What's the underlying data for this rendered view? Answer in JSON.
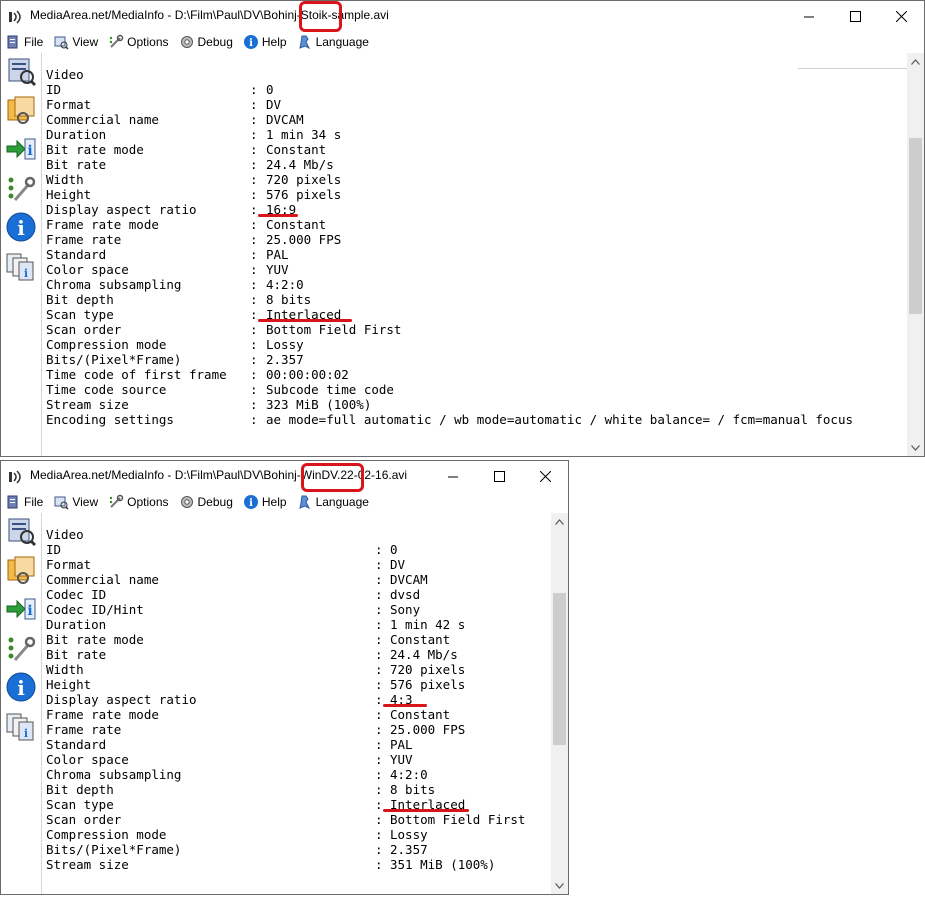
{
  "windows": [
    {
      "title": "MediaArea.net/MediaInfo - D:\\Film\\Paul\\DV\\Bohinj-Stoik-sample.avi",
      "menu": [
        {
          "label": "File",
          "icon": "file-icon"
        },
        {
          "label": "View",
          "icon": "view-icon"
        },
        {
          "label": "Options",
          "icon": "options-icon"
        },
        {
          "label": "Debug",
          "icon": "debug-icon"
        },
        {
          "label": "Help",
          "icon": "help-icon"
        },
        {
          "label": "Language",
          "icon": "language-icon"
        }
      ],
      "section": "Video",
      "rows": [
        {
          "key": "ID",
          "value": "0"
        },
        {
          "key": "Format",
          "value": "DV"
        },
        {
          "key": "Commercial name",
          "value": "DVCAM"
        },
        {
          "key": "Duration",
          "value": "1 min 34 s"
        },
        {
          "key": "Bit rate mode",
          "value": "Constant"
        },
        {
          "key": "Bit rate",
          "value": "24.4 Mb/s"
        },
        {
          "key": "Width",
          "value": "720 pixels"
        },
        {
          "key": "Height",
          "value": "576 pixels"
        },
        {
          "key": "Display aspect ratio",
          "value": "16:9"
        },
        {
          "key": "Frame rate mode",
          "value": "Constant"
        },
        {
          "key": "Frame rate",
          "value": "25.000 FPS"
        },
        {
          "key": "Standard",
          "value": "PAL"
        },
        {
          "key": "Color space",
          "value": "YUV"
        },
        {
          "key": "Chroma subsampling",
          "value": "4:2:0"
        },
        {
          "key": "Bit depth",
          "value": "8 bits"
        },
        {
          "key": "Scan type",
          "value": "Interlaced"
        },
        {
          "key": "Scan order",
          "value": "Bottom Field First"
        },
        {
          "key": "Compression mode",
          "value": "Lossy"
        },
        {
          "key": "Bits/(Pixel*Frame)",
          "value": "2.357"
        },
        {
          "key": "Time code of first frame",
          "value": "00:00:00:02"
        },
        {
          "key": "Time code source",
          "value": "Subcode time code"
        },
        {
          "key": "Stream size",
          "value": "323 MiB (100%)"
        },
        {
          "key": "Encoding settings",
          "value": "ae mode=full automatic / wb mode=automatic / white balance= / fcm=manual focus"
        }
      ]
    },
    {
      "title": "MediaArea.net/MediaInfo - D:\\Film\\Paul\\DV\\Bohinj-WinDV.22-02-16.avi",
      "menu": [
        {
          "label": "File",
          "icon": "file-icon"
        },
        {
          "label": "View",
          "icon": "view-icon"
        },
        {
          "label": "Options",
          "icon": "options-icon"
        },
        {
          "label": "Debug",
          "icon": "debug-icon"
        },
        {
          "label": "Help",
          "icon": "help-icon"
        },
        {
          "label": "Language",
          "icon": "language-icon"
        }
      ],
      "section": "Video",
      "rows": [
        {
          "key": "ID",
          "value": "0"
        },
        {
          "key": "Format",
          "value": "DV"
        },
        {
          "key": "Commercial name",
          "value": "DVCAM"
        },
        {
          "key": "Codec ID",
          "value": "dvsd"
        },
        {
          "key": "Codec ID/Hint",
          "value": "Sony"
        },
        {
          "key": "Duration",
          "value": "1 min 42 s"
        },
        {
          "key": "Bit rate mode",
          "value": "Constant"
        },
        {
          "key": "Bit rate",
          "value": "24.4 Mb/s"
        },
        {
          "key": "Width",
          "value": "720 pixels"
        },
        {
          "key": "Height",
          "value": "576 pixels"
        },
        {
          "key": "Display aspect ratio",
          "value": "4:3"
        },
        {
          "key": "Frame rate mode",
          "value": "Constant"
        },
        {
          "key": "Frame rate",
          "value": "25.000 FPS"
        },
        {
          "key": "Standard",
          "value": "PAL"
        },
        {
          "key": "Color space",
          "value": "YUV"
        },
        {
          "key": "Chroma subsampling",
          "value": "4:2:0"
        },
        {
          "key": "Bit depth",
          "value": "8 bits"
        },
        {
          "key": "Scan type",
          "value": "Interlaced"
        },
        {
          "key": "Scan order",
          "value": "Bottom Field First"
        },
        {
          "key": "Compression mode",
          "value": "Lossy"
        },
        {
          "key": "Bits/(Pixel*Frame)",
          "value": "2.357"
        },
        {
          "key": "Stream size",
          "value": "351 MiB (100%)"
        }
      ]
    }
  ],
  "separator": ":",
  "sidebar_icons": [
    "easy-view-icon",
    "sheet-view-icon",
    "export-icon",
    "settings-icon",
    "about-icon",
    "compare-icon"
  ],
  "annotation_color": "#d9151b"
}
